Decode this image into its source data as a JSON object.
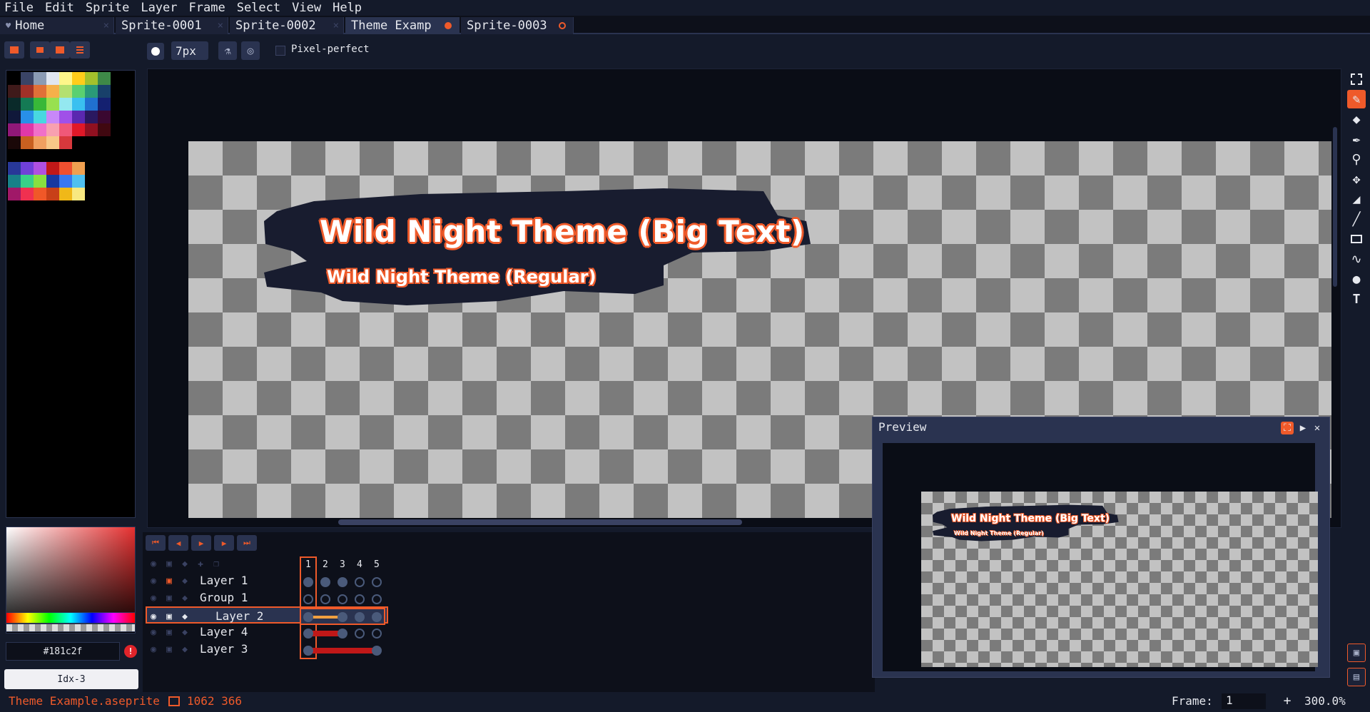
{
  "menu": [
    "File",
    "Edit",
    "Sprite",
    "Layer",
    "Frame",
    "Select",
    "View",
    "Help"
  ],
  "tabs": [
    {
      "label": "Home",
      "icon": "heart-icon"
    },
    {
      "label": "Sprite-0001"
    },
    {
      "label": "Sprite-0002"
    },
    {
      "label": "Theme Examp",
      "modified": true
    },
    {
      "label": "Sprite-0003",
      "modified": true
    }
  ],
  "context_bar": {
    "brush_size": "7px",
    "pixel_perfect_label": "Pixel-perfect",
    "pixel_perfect_checked": false
  },
  "canvas": {
    "big_text": "Wild Night Theme (Big Text)",
    "regular_text": "Wild Night Theme (Regular)"
  },
  "color": {
    "hex_label": "#181c2f",
    "index_label": "Idx-3",
    "accent": "#ef5a2a",
    "background": "#141a2a"
  },
  "timeline": {
    "frame_numbers": [
      "1",
      "2",
      "3",
      "4",
      "5"
    ],
    "layers": [
      {
        "name": "Layer 1",
        "locked": true
      },
      {
        "name": "Group 1",
        "is_group": true
      },
      {
        "name": "Layer 2",
        "selected": true,
        "indented": true
      },
      {
        "name": "Layer 4"
      },
      {
        "name": "Layer 3"
      }
    ]
  },
  "preview": {
    "title": "Preview",
    "big_text": "Wild Night Theme (Big Text)",
    "regular_text": "Wild Night Theme (Regular)"
  },
  "status": {
    "filename": "Theme Example.aseprite",
    "position": "1062 366",
    "frame_label": "Frame:",
    "frame_value": "1",
    "plus": "+",
    "zoom": "300.0%"
  }
}
